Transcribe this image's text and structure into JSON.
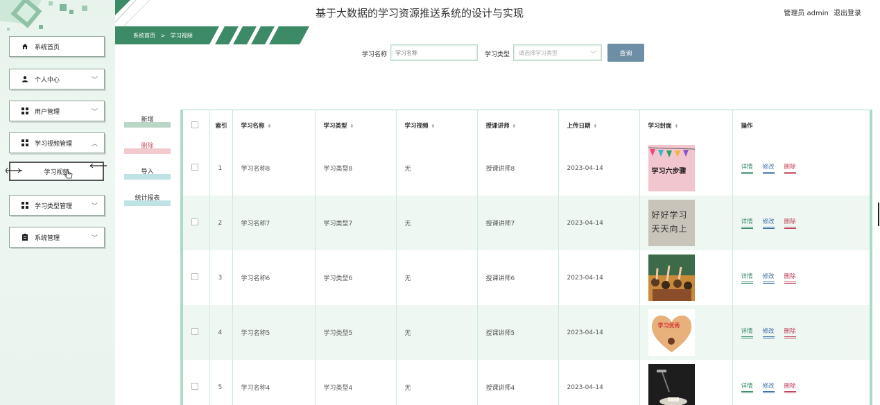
{
  "app": {
    "title": "基于大数据的学习资源推送系统的设计与实现",
    "user_label": "管理员 admin",
    "logout_label": "退出登录"
  },
  "breadcrumb": {
    "home": "系统首页",
    "sep": ">",
    "current": "学习视频"
  },
  "sidebar": {
    "items": [
      {
        "label": "系统首页",
        "icon": "home-icon"
      },
      {
        "label": "个人中心",
        "icon": "user-icon"
      },
      {
        "label": "用户管理",
        "icon": "grid-icon"
      },
      {
        "label": "学习视频管理",
        "icon": "grid-icon"
      },
      {
        "label": "学习视频",
        "icon": "none"
      },
      {
        "label": "学习类型管理",
        "icon": "grid-icon"
      },
      {
        "label": "系统管理",
        "icon": "clipboard-icon"
      }
    ]
  },
  "search": {
    "name_label": "学习名称",
    "name_placeholder": "学习名称",
    "type_label": "学习类型",
    "type_placeholder": "请选择学习类型",
    "button_label": "查询"
  },
  "actions": {
    "add": "新增",
    "delete": "删除",
    "import": "导入",
    "report": "统计报表"
  },
  "colors": {
    "accent_green": "#3d8a66",
    "search_button": "#6d8ea4",
    "add_bar": "#b9d6c6",
    "delete_bar": "#f2c9cc",
    "import_bar": "#bfe3e4",
    "report_bar": "#bfe3e4"
  },
  "table": {
    "headers": {
      "index": "索引",
      "name": "学习名称",
      "type": "学习类型",
      "video": "学习视频",
      "teacher": "授课讲师",
      "date": "上传日期",
      "cover": "学习封面",
      "ops": "操作"
    },
    "op_labels": {
      "detail": "详情",
      "edit": "修改",
      "del": "删除"
    },
    "rows": [
      {
        "index": "1",
        "name": "学习名称8",
        "type": "学习类型8",
        "video": "无",
        "teacher": "授课讲师8",
        "date": "2023-04-14",
        "cover_text": "学习六步骤"
      },
      {
        "index": "2",
        "name": "学习名称7",
        "type": "学习类型7",
        "video": "无",
        "teacher": "授课讲师7",
        "date": "2023-04-14",
        "cover_text": "好好学习天天向上"
      },
      {
        "index": "3",
        "name": "学习名称6",
        "type": "学习类型6",
        "video": "无",
        "teacher": "授课讲师6",
        "date": "2023-04-14",
        "cover_text": ""
      },
      {
        "index": "4",
        "name": "学习名称5",
        "type": "学习类型5",
        "video": "无",
        "teacher": "授课讲师5",
        "date": "2023-04-14",
        "cover_text": "学习优秀"
      },
      {
        "index": "5",
        "name": "学习名称4",
        "type": "学习类型4",
        "video": "无",
        "teacher": "授课讲师4",
        "date": "2023-04-14",
        "cover_text": ""
      }
    ]
  }
}
